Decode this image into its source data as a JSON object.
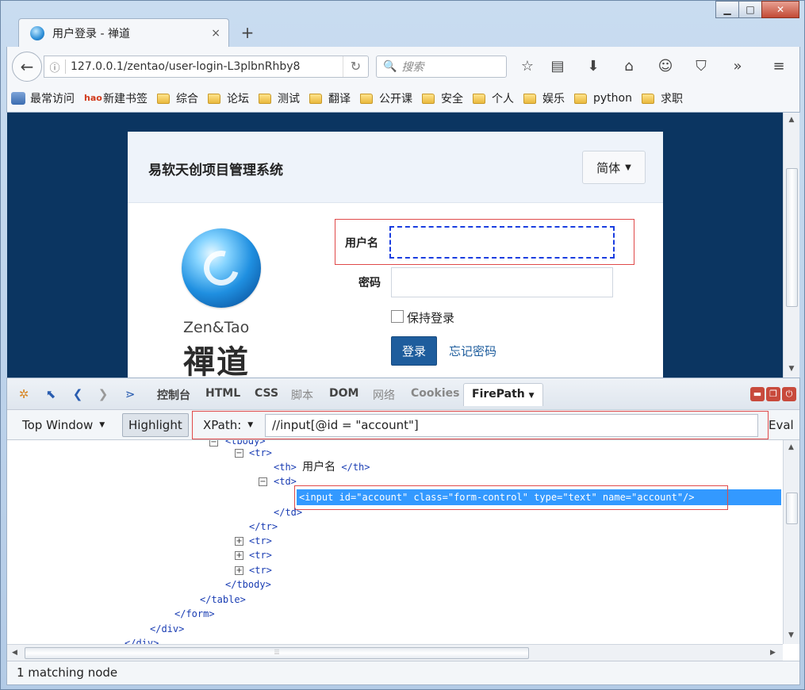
{
  "window": {
    "minimize_glyph": "▁",
    "maximize_glyph": "□",
    "close_glyph": "✕"
  },
  "tab": {
    "title": "用户登录 - 禅道",
    "close_glyph": "×",
    "new_tab_glyph": "+"
  },
  "navbar": {
    "back_glyph": "←",
    "info_glyph": "ⓘ",
    "url": "127.0.0.1/zentao/user-login-L3plbnRhby8",
    "reload_glyph": "↻",
    "search_placeholder": "搜索",
    "search_glyph": "🔍",
    "icons": [
      "star-icon",
      "reading-list-icon",
      "download-icon",
      "home-icon",
      "smiley-icon",
      "pocket-icon",
      "overflow-icon",
      "menu-icon"
    ],
    "icon_glyphs": {
      "star": "☆",
      "reading": "▤",
      "download": "⬇",
      "home": "⌂",
      "smiley": "☺",
      "pocket": "⛉",
      "overflow": "»",
      "menu": "≡"
    }
  },
  "bookmarks": [
    {
      "label": "最常访问",
      "icon": "most-visited-icon"
    },
    {
      "label": "新建书签",
      "icon": "hao-icon"
    },
    {
      "label": "综合",
      "icon": "folder-icon"
    },
    {
      "label": "论坛",
      "icon": "folder-icon"
    },
    {
      "label": "测试",
      "icon": "folder-icon"
    },
    {
      "label": "翻译",
      "icon": "folder-icon"
    },
    {
      "label": "公开课",
      "icon": "folder-icon"
    },
    {
      "label": "安全",
      "icon": "folder-icon"
    },
    {
      "label": "个人",
      "icon": "folder-icon"
    },
    {
      "label": "娱乐",
      "icon": "folder-icon"
    },
    {
      "label": "python",
      "icon": "folder-icon"
    },
    {
      "label": "求职",
      "icon": "folder-icon"
    }
  ],
  "login": {
    "title": "易软天创项目管理系统",
    "lang_label": "简体",
    "logo_name": "Zen&Tao",
    "logo_cn": "禪道",
    "username_label": "用户名",
    "username_value": "",
    "password_label": "密码",
    "password_value": "",
    "keep_login_label": "保持登录",
    "login_button": "登录",
    "forgot_link": "忘记密码"
  },
  "devtools": {
    "tabs": [
      "控制台",
      "HTML",
      "CSS",
      "脚本",
      "DOM",
      "网络",
      "Cookies",
      "FirePath"
    ],
    "active_tab": "FirePath",
    "firepath": {
      "scope_label": "Top Window",
      "highlight_label": "Highlight",
      "xpath_label": "XPath:",
      "xpath_value": "//input[@id = \"account\"]",
      "eval_label": "Eval"
    },
    "tree": {
      "tbody_open": "<tbody>",
      "tr_open": "<tr>",
      "th_line_open": "<th>",
      "th_text": "用户名",
      "th_line_close": "</th>",
      "td_open": "<td>",
      "selected_line": "<input  id=\"account\"  class=\"form-control\"  type=\"text\"  name=\"account\"/>",
      "td_close": "</td>",
      "tr_close": "</tr>",
      "tbody_close": "</tbody>",
      "table_close": "</table>",
      "form_close": "</form>",
      "div_close": "</div>",
      "div_close2": "</div>"
    },
    "status": "1 matching node"
  }
}
